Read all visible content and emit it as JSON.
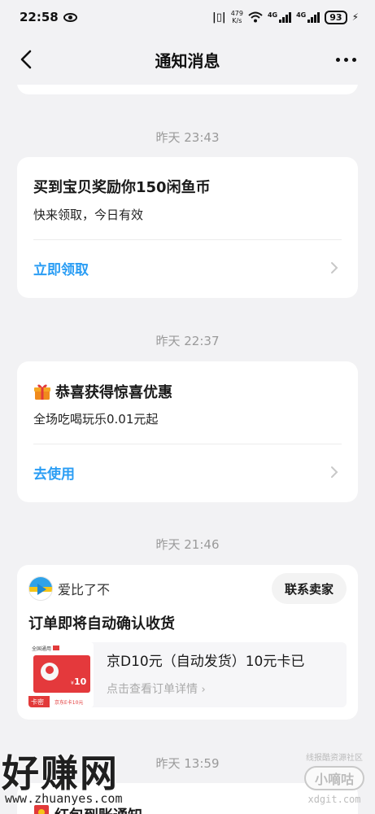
{
  "status_bar": {
    "time": "22:58",
    "speed_value": "479",
    "speed_unit": "K/s",
    "net1": "4G",
    "net2": "4G",
    "battery": "93"
  },
  "header": {
    "title": "通知消息"
  },
  "messages": [
    {
      "time": "昨天 23:43",
      "title": "买到宝贝奖励你150闲鱼币",
      "subtitle": "快来领取，今日有效",
      "action": "立即领取"
    },
    {
      "time": "昨天 22:37",
      "title": "恭喜获得惊喜优惠",
      "subtitle": "全场吃喝玩乐0.01元起",
      "action": "去使用",
      "icon": "gift-icon"
    },
    {
      "time": "昨天 21:46",
      "shop_name": "爱比了不",
      "contact_label": "联系卖家",
      "title": "订单即将自动确认收货",
      "product_name": "京D10元（自动发货）10元卡已",
      "product_detail": "点击查看订单详情",
      "thumb": {
        "brand": "全国通用",
        "badge": "卡密",
        "card_value": "10",
        "caption": "京东E卡10元"
      }
    },
    {
      "time": "昨天 13:59",
      "title": "红包到账通知"
    }
  ],
  "watermarks": {
    "left_big": "好赚网",
    "left_url": "www.zhuanyes.com",
    "right_top": "线报酷资源社区",
    "right_badge": "小嘀咕",
    "right_domain": "xdgit.com"
  },
  "colors": {
    "background": "#f2f2f4",
    "card": "#ffffff",
    "action_blue": "#2a9df4",
    "timestamp_gray": "#9a9a9a",
    "accent_red": "#e23a3a"
  }
}
